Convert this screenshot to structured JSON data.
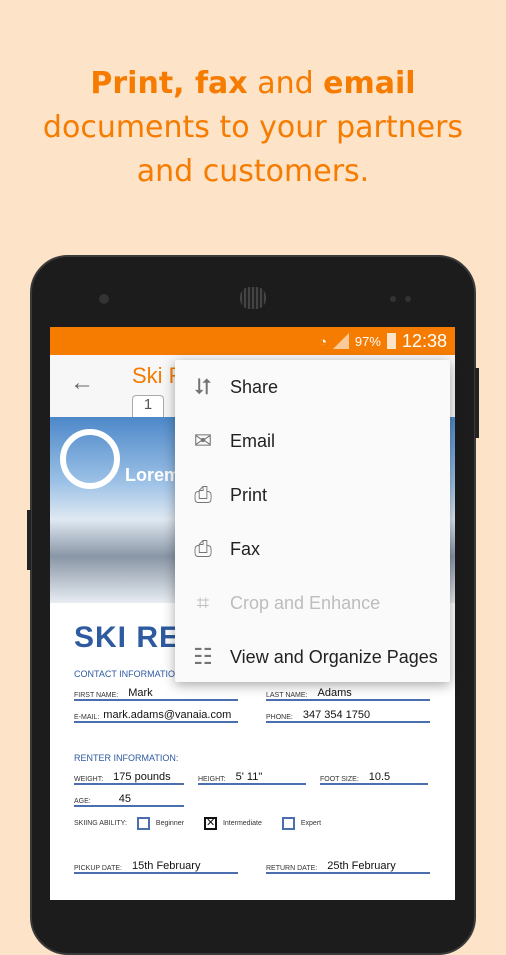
{
  "headline": {
    "line1_a": "Print, fax",
    "line1_b": " and ",
    "line1_c": "email",
    "line2": "documents to your partners",
    "line3": "and customers."
  },
  "status": {
    "battery": "97%",
    "time": "12:38"
  },
  "toolbar": {
    "title": "Ski R",
    "page_tab": "1"
  },
  "hero": {
    "logo_text": "Lorem"
  },
  "document": {
    "title": "SKI RENTA",
    "contact_heading": "CONTACT INFORMATION:",
    "first_name_label": "FIRST NAME:",
    "first_name": "Mark",
    "last_name_label": "LAST NAME:",
    "last_name": "Adams",
    "email_label": "E-MAIL:",
    "email": "mark.adams@vanaia.com",
    "phone_label": "PHONE:",
    "phone": "347 354 1750",
    "renter_heading": "RENTER  INFORMATION:",
    "weight_label": "WEIGHT:",
    "weight": "175 pounds",
    "height_label": "HEIGHT:",
    "height": "5' 11\"",
    "foot_label": "FOOT SIZE:",
    "foot": "10.5",
    "age_label": "AGE:",
    "age": "45",
    "ability_label": "SKIING ABILITY:",
    "abilities": [
      "Beginner",
      "Intermediate",
      "Expert"
    ],
    "ability_selected": "Intermediate",
    "pickup_label": "PICKUP DATE:",
    "pickup": "15th February",
    "return_label": "RETURN DATE:",
    "return": "25th February"
  },
  "menu": {
    "items": [
      {
        "label": "Share",
        "icon": "share-icon",
        "enabled": true
      },
      {
        "label": "Email",
        "icon": "email-icon",
        "enabled": true
      },
      {
        "label": "Print",
        "icon": "print-icon",
        "enabled": true
      },
      {
        "label": "Fax",
        "icon": "fax-icon",
        "enabled": true
      },
      {
        "label": "Crop and Enhance",
        "icon": "crop-icon",
        "enabled": false
      },
      {
        "label": "View and Organize Pages",
        "icon": "grid-icon",
        "enabled": true
      }
    ]
  },
  "colors": {
    "accent": "#f57c00",
    "background": "#fde3c8",
    "form_blue": "#2e5aa0"
  }
}
